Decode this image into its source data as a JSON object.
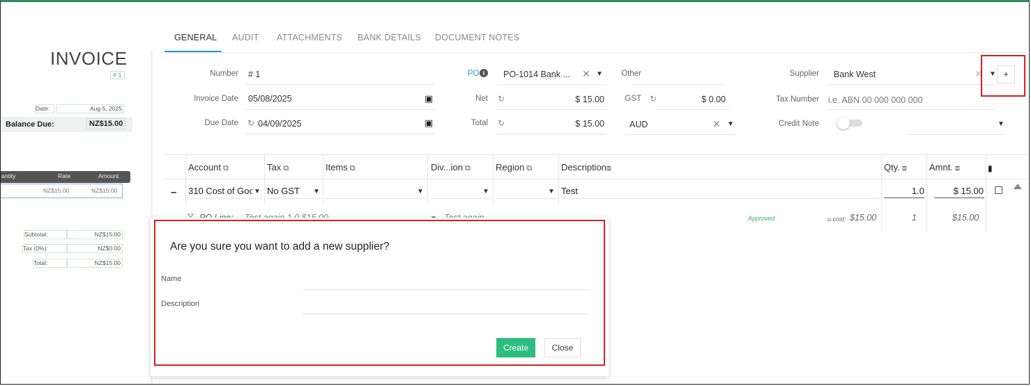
{
  "tabs": [
    "GENERAL",
    "AUDIT",
    "ATTACHMENTS",
    "BANK DETAILS",
    "DOCUMENT NOTES"
  ],
  "preview": {
    "title": "INVOICE",
    "number": "# 1",
    "date_label": "Date:",
    "date_value": "Aug 5, 2025",
    "balance_label": "Balance Due:",
    "balance_value": "NZ$15.00",
    "col_quantity": "antity",
    "col_rate": "Rate",
    "col_amount": "Amount",
    "row_rate": "NZ$15.00",
    "row_amount": "NZ$15.00",
    "subtotal_label": "Subtotal:",
    "subtotal_value": "NZ$15.00",
    "tax_label": "Tax (0%):",
    "tax_value": "NZ$0.00",
    "total_label": "Total:",
    "total_value": "NZ$15.00"
  },
  "form": {
    "number_label": "Number",
    "number_value": "# 1",
    "invoice_date_label": "Invoice Date",
    "invoice_date_value": "05/08/2025",
    "due_date_label": "Due Date",
    "due_date_value": "04/09/2025",
    "po_label": "PO",
    "po_value": "PO-1014 Bank ...",
    "net_label": "Net",
    "net_value": "$ 15.00",
    "total_label": "Total",
    "total_value": "$ 15.00",
    "other_label": "Other",
    "gst_label": "GST",
    "gst_value": "$ 0.00",
    "currency_value": "AUD",
    "supplier_label": "Supplier",
    "supplier_value": "Bank West",
    "tax_number_label": "Tax Number",
    "tax_number_placeholder": "i.e. ABN 00 000 000 000",
    "credit_note_label": "Credit Note",
    "plus_label": "+"
  },
  "grid": {
    "headers": [
      "Account",
      "Tax",
      "Items",
      "Div...ion",
      "Region",
      "Description",
      "Qty.",
      "Amnt."
    ],
    "row": {
      "account": "310 Cost of Goo",
      "tax": "No GST",
      "description": "Test",
      "qty": "1.0",
      "amount": "$ 15.00"
    },
    "po_line": {
      "label": "PO Line:",
      "text": "Test again 1.0 $15.00",
      "description": "Test again",
      "status": "Approved",
      "ucost_label": "u.cost:",
      "ucost_value": "$15.00",
      "qty": "1",
      "amount": "$15.00"
    }
  },
  "modal": {
    "title": "Are you sure you want to add a new supplier?",
    "name_label": "Name",
    "description_label": "Description",
    "create_label": "Create",
    "close_label": "Close"
  },
  "colors": {
    "accent": "#1e9bd7",
    "create": "#2ebd7e",
    "highlight": "#d42020",
    "approved": "#3cae66"
  }
}
